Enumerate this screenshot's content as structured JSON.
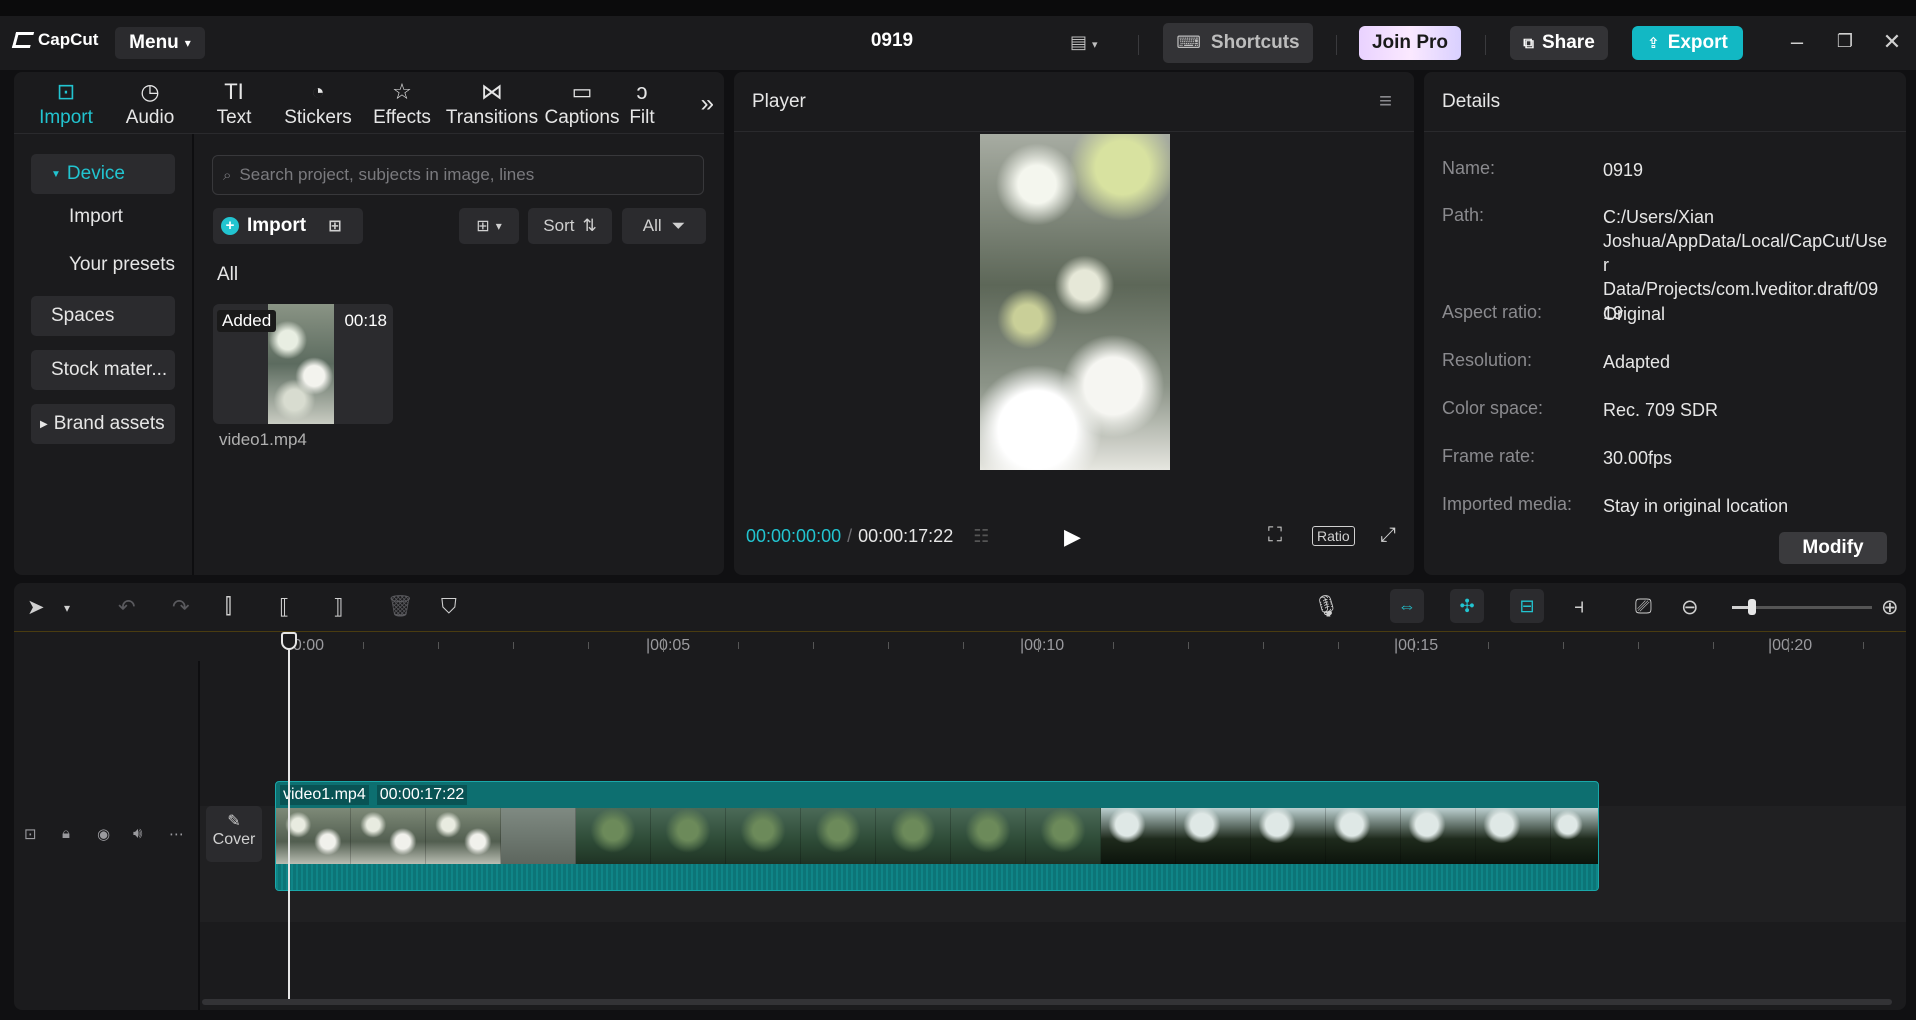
{
  "topbar": {
    "logo": "CapCut",
    "menu_label": "Menu",
    "project_title": "0919",
    "shortcuts_label": "Shortcuts",
    "join_pro_label": "Join Pro",
    "share_label": "Share",
    "export_label": "Export"
  },
  "media_tabs": [
    {
      "label": "Import",
      "icon": "import-icon"
    },
    {
      "label": "Audio",
      "icon": "audio-icon"
    },
    {
      "label": "Text",
      "icon": "text-icon"
    },
    {
      "label": "Stickers",
      "icon": "stickers-icon"
    },
    {
      "label": "Effects",
      "icon": "effects-icon"
    },
    {
      "label": "Transitions",
      "icon": "transitions-icon"
    },
    {
      "label": "Captions",
      "icon": "captions-icon"
    },
    {
      "label": "Filt",
      "icon": "filters-icon"
    }
  ],
  "sidenav": {
    "device": "Device",
    "import": "Import",
    "your_presets": "Your presets",
    "spaces": "Spaces",
    "stock": "Stock mater...",
    "brand_assets": "Brand assets"
  },
  "media": {
    "search_placeholder": "Search project, subjects in image, lines",
    "import_label": "Import",
    "sort_label": "Sort",
    "all_filter": "All",
    "section_label": "All",
    "items": [
      {
        "badge": "Added",
        "duration": "00:18",
        "name": "video1.mp4"
      }
    ]
  },
  "player": {
    "title": "Player",
    "current_time": "00:00:00:00",
    "separator": "/",
    "total_time": "00:00:17:22",
    "ratio_label": "Ratio"
  },
  "details": {
    "title": "Details",
    "rows": [
      {
        "key": "Name:",
        "value": "0919"
      },
      {
        "key": "Path:",
        "value": "C:/Users/Xian Joshua/AppData/Local/CapCut/User Data/Projects/com.lveditor.draft/0919"
      },
      {
        "key": "Aspect ratio:",
        "value": "Original"
      },
      {
        "key": "Resolution:",
        "value": "Adapted"
      },
      {
        "key": "Color space:",
        "value": "Rec. 709 SDR"
      },
      {
        "key": "Frame rate:",
        "value": "30.00fps"
      },
      {
        "key": "Imported media:",
        "value": "Stay in original location"
      }
    ],
    "modify_label": "Modify"
  },
  "timeline": {
    "ruler_labels": [
      "00:00",
      "|00:05",
      "|00:10",
      "|00:15",
      "|00:20"
    ],
    "cover_label": "Cover",
    "clip_name": "video1.mp4",
    "clip_duration": "00:00:17:22",
    "zoom_level": 0.14
  },
  "colors": {
    "accent": "#22c4d0",
    "clip": "#0d6f70",
    "panel": "#1b1b1d"
  }
}
